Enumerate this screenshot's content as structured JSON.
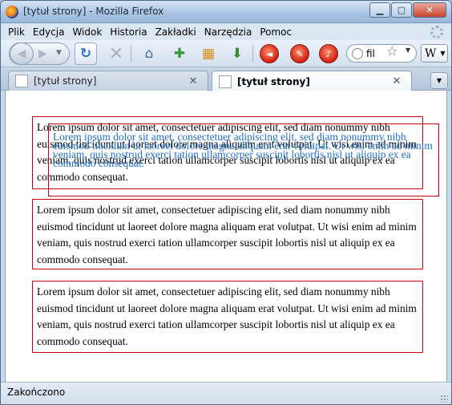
{
  "window": {
    "title": "[tytuł strony] - Mozilla Firefox",
    "minimize_glyph": "▁",
    "maximize_glyph": "▢",
    "close_glyph": "✕"
  },
  "menu": [
    "Plik",
    "Edycja",
    "Widok",
    "Historia",
    "Zakładki",
    "Narzędzia",
    "Pomoc"
  ],
  "toolbar": {
    "search_value": "fil",
    "search_engine_label": "W"
  },
  "tabs": [
    {
      "title": "[tytuł strony]",
      "active": false
    },
    {
      "title": "[tytuł strony]",
      "active": true
    }
  ],
  "content": {
    "paragraph": "Lorem ipsum dolor sit amet, consectetuer adipiscing elit, sed diam nonummy nibh euismod tincidunt ut laoreet dolore magna aliquam erat volutpat. Ut wisi enim ad minim veniam, quis nostrud exerci tation ullamcorper suscipit lobortis nisl ut aliquip ex ea commodo consequat."
  },
  "status": {
    "text": "Zakończono"
  },
  "colors": {
    "box_border": "#c0000a",
    "overlay_text": "#1e6fcf"
  }
}
